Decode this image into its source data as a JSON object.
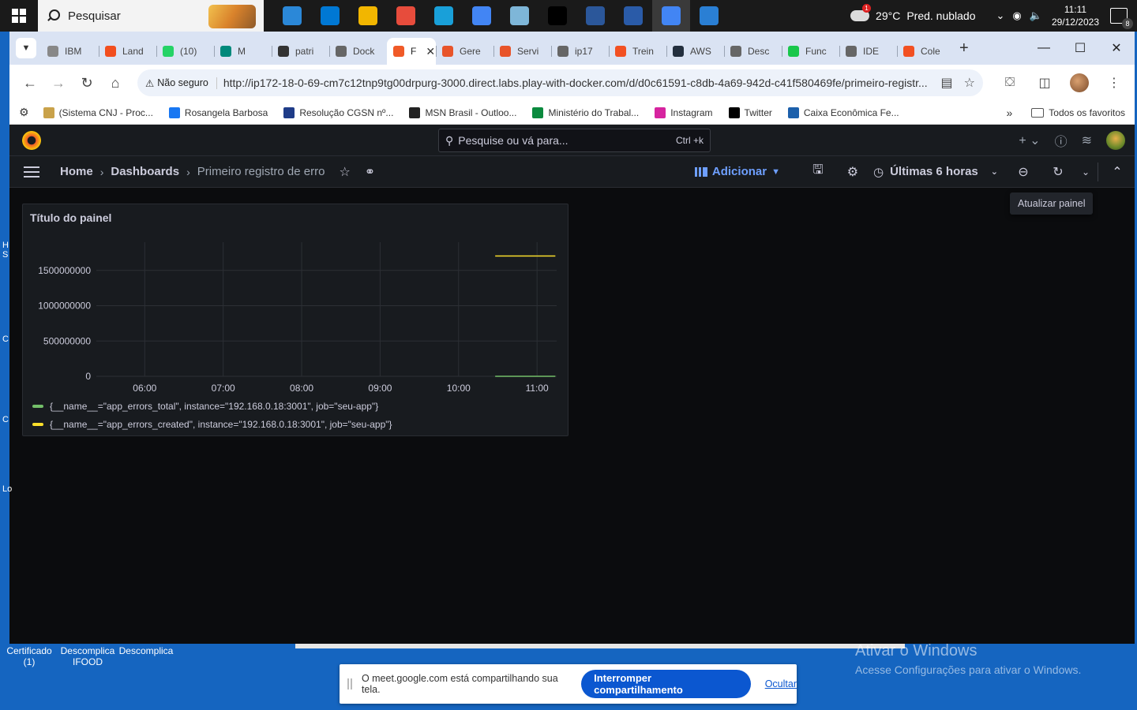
{
  "taskbar": {
    "search_placeholder": "Pesquisar",
    "weather_temp": "29°C",
    "weather_desc": "Pred. nublado",
    "time": "11:11",
    "date": "29/12/2023",
    "notification_count": "8",
    "apps": [
      "#2b88d8",
      "#0078d4",
      "#f2b600",
      "#e74c3c",
      "#19a0d9",
      "#4285f4",
      "#7eb6d8",
      "#000000",
      "#2b579a",
      "#2a5ba8",
      "#4285f4",
      "#2a7fd4"
    ]
  },
  "browser": {
    "tabs": [
      {
        "label": "IBM",
        "color": "#888888"
      },
      {
        "label": "Land",
        "color": "#f24e1e"
      },
      {
        "label": "(10)",
        "color": "#25d366"
      },
      {
        "label": "M",
        "color": "#00897b"
      },
      {
        "label": "patri",
        "color": "#333333"
      },
      {
        "label": "Dock",
        "color": "#666666"
      },
      {
        "label": "F",
        "color": "#f05a28"
      },
      {
        "label": "Gere",
        "color": "#e8542a"
      },
      {
        "label": "Servi",
        "color": "#e8542a"
      },
      {
        "label": "ip17",
        "color": "#666666"
      },
      {
        "label": "Trein",
        "color": "#f25022"
      },
      {
        "label": "AWS",
        "color": "#232f3e"
      },
      {
        "label": "Desc",
        "color": "#666666"
      },
      {
        "label": "Func",
        "color": "#19c74b"
      },
      {
        "label": "IDE",
        "color": "#666666"
      },
      {
        "label": "Cole",
        "color": "#f25022"
      }
    ],
    "active_tab_index": 6,
    "security_label": "Não seguro",
    "url": "http://ip172-18-0-69-cm7c12tnp9tg00drpurg-3000.direct.labs.play-with-docker.com/d/d0c61591-c8db-4a69-942d-c41f580469fe/primeiro-registr...",
    "bookmarks": [
      {
        "label": "(Sistema CNJ - Proc...",
        "color": "#c9a24a"
      },
      {
        "label": "Rosangela Barbosa",
        "color": "#1877f2"
      },
      {
        "label": "Resolução CGSN nº...",
        "color": "#1f3c88"
      },
      {
        "label": "MSN Brasil - Outloo...",
        "color": "#222222"
      },
      {
        "label": "Ministério do Trabal...",
        "color": "#0b8a3e"
      },
      {
        "label": "Instagram",
        "color": "#d6249f"
      },
      {
        "label": "Twitter",
        "color": "#000000"
      },
      {
        "label": "Caixa Econômica Fe...",
        "color": "#1c60ab"
      }
    ],
    "all_favorites": "Todos os favoritos"
  },
  "grafana": {
    "search_placeholder": "Pesquise ou vá para...",
    "search_shortcut": "Ctrl +k",
    "breadcrumb": {
      "home": "Home",
      "dashboards": "Dashboards",
      "current": "Primeiro registro de erro"
    },
    "add_label": "Adicionar",
    "time_range": "Últimas 6 horas",
    "tooltip": "Atualizar painel",
    "panel_title": "Título do painel"
  },
  "chart_data": {
    "type": "line",
    "title": "Título do painel",
    "xlabel": "",
    "ylabel": "",
    "x_ticks": [
      "06:00",
      "07:00",
      "08:00",
      "09:00",
      "10:00",
      "11:00"
    ],
    "y_ticks": [
      "0",
      "500000000",
      "1000000000",
      "1500000000"
    ],
    "ylim": [
      0,
      1900000000
    ],
    "xlim": [
      "05:23",
      "11:15"
    ],
    "series": [
      {
        "name": "{__name__=\"app_errors_total\", instance=\"192.168.0.18:3001\", job=\"seu-app\"}",
        "color": "#73bf69",
        "x": [
          "10:28",
          "11:14"
        ],
        "y": [
          1,
          1
        ]
      },
      {
        "name": "{__name__=\"app_errors_created\", instance=\"192.168.0.18:3001\", job=\"seu-app\"}",
        "color": "#fade2a",
        "x": [
          "10:28",
          "11:14"
        ],
        "y": [
          1703850000,
          1703850000
        ]
      }
    ],
    "grid": true,
    "legend": "bottom"
  },
  "desktop": {
    "icons": [
      "Certificado (1)",
      "Descomplica IFOOD",
      "Descomplica"
    ],
    "activate_title": "Ativar o Windows",
    "activate_sub": "Acesse Configurações para ativar o Windows."
  },
  "share_bar": {
    "message": "O meet.google.com está compartilhando sua tela.",
    "stop_label": "Interromper compartilhamento",
    "hide_label": "Ocultar"
  }
}
